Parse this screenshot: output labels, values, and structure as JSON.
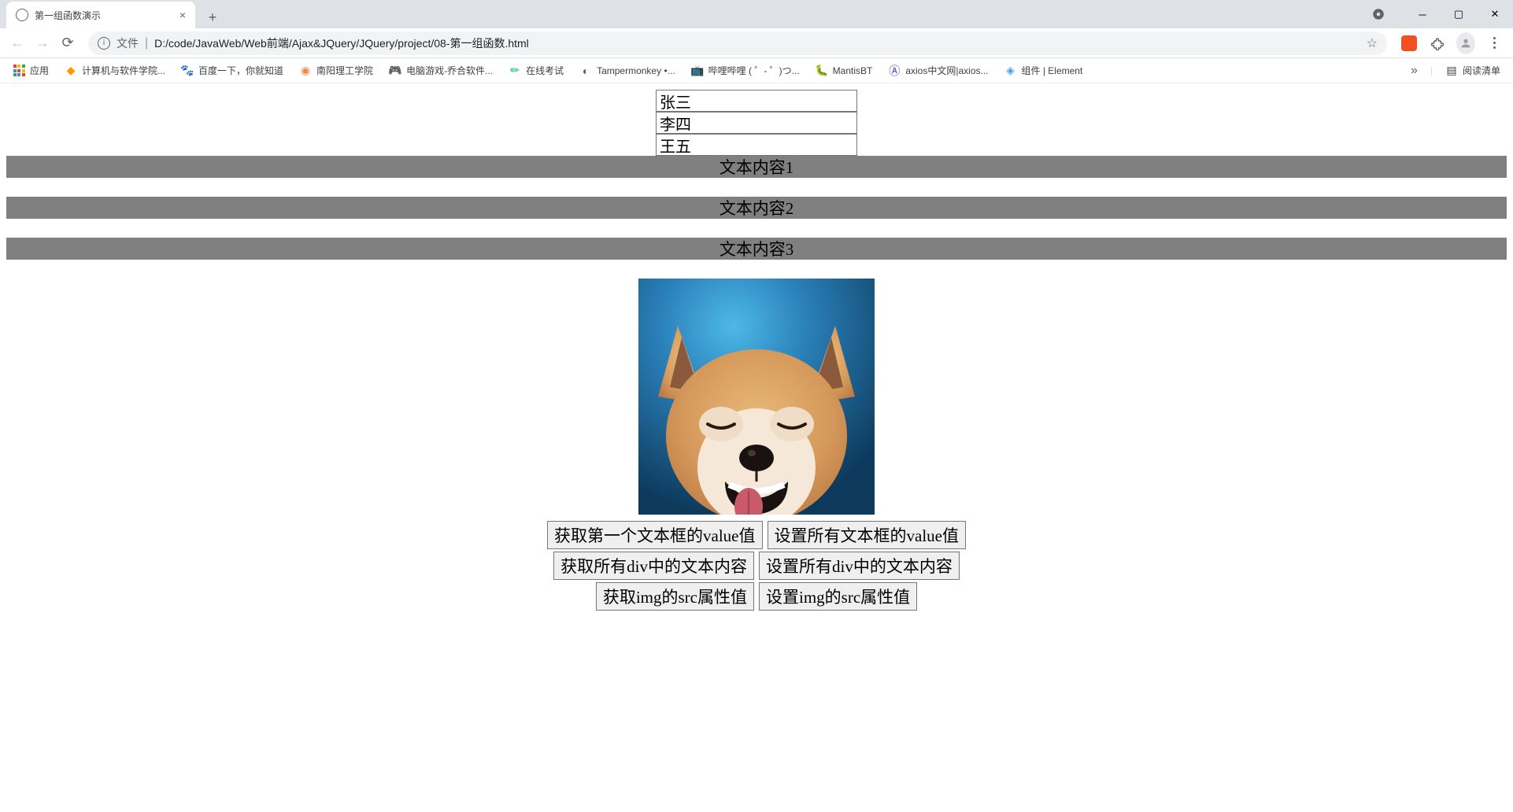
{
  "browser": {
    "tab_title": "第一组函数演示",
    "address_label": "文件",
    "address_path": "D:/code/JavaWeb/Web前端/Ajax&JQuery/JQuery/project/08-第一组函数.html",
    "bookmarks": [
      "应用",
      "计算机与软件学院...",
      "百度一下，你就知道",
      "南阳理工学院",
      "电脑游戏-乔合软件...",
      "在线考试",
      "Tampermonkey •...",
      "哔哩哔哩 ( ゜- ゜)つ...",
      "MantisBT",
      "axios中文网|axios...",
      "组件 | Element"
    ],
    "reading_list": "阅读清单"
  },
  "page": {
    "inputs": [
      "张三",
      "李四",
      "王五"
    ],
    "bars": [
      "文本内容1",
      "文本内容2",
      "文本内容3"
    ],
    "image_alt": "shiba-dog",
    "buttons": {
      "row1": [
        "获取第一个文本框的value值",
        "设置所有文本框的value值"
      ],
      "row2": [
        "获取所有div中的文本内容",
        "设置所有div中的文本内容"
      ],
      "row3": [
        "获取img的src属性值",
        "设置img的src属性值"
      ]
    }
  }
}
